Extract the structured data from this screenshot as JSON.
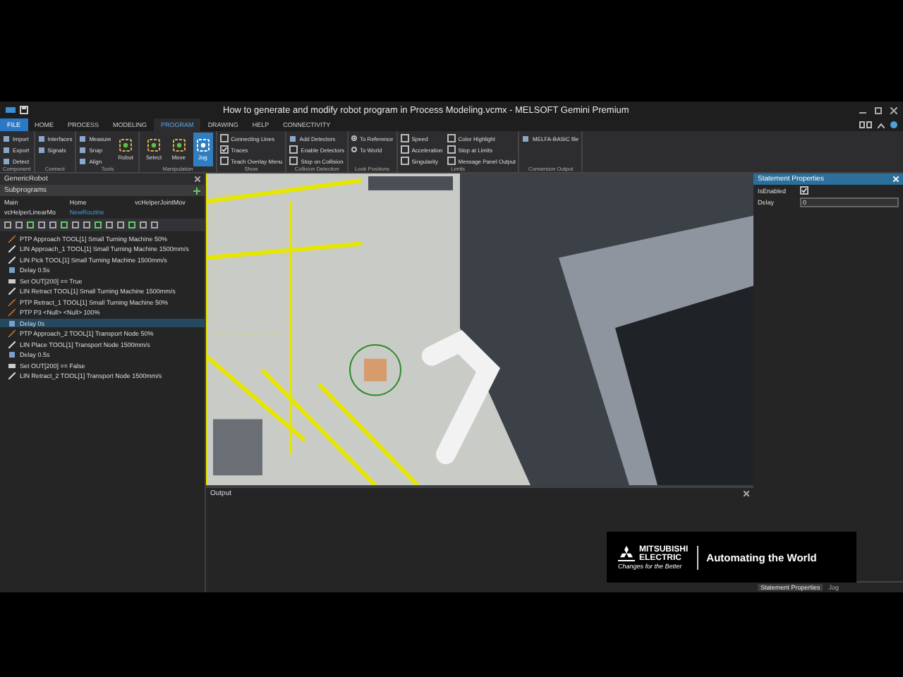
{
  "window": {
    "title": "How to generate and modify robot program in Process Modeling.vcmx - MELSOFT Gemini Premium"
  },
  "menu_tabs": [
    {
      "label": "FILE",
      "kind": "file",
      "selected": false
    },
    {
      "label": "HOME",
      "kind": "tab",
      "selected": false
    },
    {
      "label": "PROCESS",
      "kind": "tab",
      "selected": false
    },
    {
      "label": "MODELING",
      "kind": "tab",
      "selected": false
    },
    {
      "label": "PROGRAM",
      "kind": "tab",
      "selected": true
    },
    {
      "label": "DRAWING",
      "kind": "tab",
      "selected": false
    },
    {
      "label": "HELP",
      "kind": "tab",
      "selected": false
    },
    {
      "label": "CONNECTIVITY",
      "kind": "tab",
      "selected": false
    }
  ],
  "ribbon": [
    {
      "name": "Component",
      "items": [
        {
          "label": "Import",
          "kind": "small"
        },
        {
          "label": "Export",
          "kind": "small"
        },
        {
          "label": "Detect",
          "kind": "small"
        }
      ]
    },
    {
      "name": "Connect",
      "items": [
        {
          "label": "Interfaces",
          "kind": "small"
        },
        {
          "label": "Signals",
          "kind": "small"
        }
      ]
    },
    {
      "name": "Tools",
      "items": [
        {
          "label": "Measure",
          "kind": "small"
        },
        {
          "label": "Snap",
          "kind": "small"
        },
        {
          "label": "Align",
          "kind": "small"
        },
        {
          "label": "Robot",
          "kind": "large",
          "selected": false
        }
      ]
    },
    {
      "name": "Manipulation",
      "items": [
        {
          "label": "Select",
          "kind": "large",
          "selected": false
        },
        {
          "label": "Move",
          "kind": "large",
          "selected": false
        },
        {
          "label": "Jog",
          "kind": "large",
          "selected": true
        }
      ]
    },
    {
      "name": "Show",
      "items": [
        {
          "label": "Connecting Lines",
          "kind": "check",
          "checked": false
        },
        {
          "label": "Traces",
          "kind": "check",
          "checked": true
        },
        {
          "label": "Teach Overlay Menu",
          "kind": "check",
          "checked": false
        }
      ]
    },
    {
      "name": "Collision Detection",
      "items": [
        {
          "label": "Add Detectors",
          "kind": "small"
        },
        {
          "label": "Enable Detectors",
          "kind": "check",
          "checked": false
        },
        {
          "label": "Stop on Collision",
          "kind": "check",
          "checked": false
        }
      ]
    },
    {
      "name": "Look Positions",
      "items": [
        {
          "label": "To Reference",
          "kind": "radio",
          "checked": true
        },
        {
          "label": "To World",
          "kind": "radio",
          "checked": false
        }
      ]
    },
    {
      "name": "Limits",
      "items": [
        {
          "label": "Speed",
          "kind": "check",
          "checked": false
        },
        {
          "label": "Acceleration",
          "kind": "check",
          "checked": false
        },
        {
          "label": "Singularity",
          "kind": "check",
          "checked": false
        },
        {
          "label": "Color Highlight",
          "kind": "check",
          "checked": false
        },
        {
          "label": "Stop at Limits",
          "kind": "check",
          "checked": false
        },
        {
          "label": "Message Panel Output",
          "kind": "check",
          "checked": false
        }
      ]
    },
    {
      "name": "Conversion Output",
      "items": [
        {
          "label": "MELFA-BASIC file",
          "kind": "small"
        }
      ]
    }
  ],
  "program_panel": {
    "title": "GenericRobot",
    "section": "Subprograms",
    "subprograms": [
      {
        "label": "Main",
        "selected": false
      },
      {
        "label": "Home",
        "selected": false
      },
      {
        "label": "vcHelperJointMov",
        "selected": false
      },
      {
        "label": "vcHelperLinearMo",
        "selected": false
      },
      {
        "label": "NewRoutine",
        "selected": true
      }
    ],
    "statements": [
      {
        "text": "PTP Approach TOOL[1] Small Turning Machine 50%",
        "kind": "ptp",
        "selected": false
      },
      {
        "text": "LIN Approach_1 TOOL[1] Small Turning Machine 1500mm/s",
        "kind": "lin",
        "selected": false
      },
      {
        "text": "LIN Pick TOOL[1] Small Turning Machine 1500mm/s",
        "kind": "lin",
        "selected": false
      },
      {
        "text": "Delay 0.5s",
        "kind": "delay",
        "selected": false
      },
      {
        "text": "Set OUT[200] == True",
        "kind": "set",
        "selected": false
      },
      {
        "text": "LIN Retract TOOL[1] Small Turning Machine 1500mm/s",
        "kind": "lin",
        "selected": false
      },
      {
        "text": "PTP Retract_1 TOOL[1] Small Turning Machine 50%",
        "kind": "ptp",
        "selected": false
      },
      {
        "text": "PTP P3 <Null> <Null> 100%",
        "kind": "ptp",
        "selected": false
      },
      {
        "text": "Delay 0s",
        "kind": "delay",
        "selected": true
      },
      {
        "text": "PTP Approach_2 TOOL[1] Transport Node 50%",
        "kind": "ptp",
        "selected": false
      },
      {
        "text": "LIN Place TOOL[1] Transport Node 1500mm/s",
        "kind": "lin",
        "selected": false
      },
      {
        "text": "Delay 0.5s",
        "kind": "delay",
        "selected": false
      },
      {
        "text": "Set OUT[200] == False",
        "kind": "set",
        "selected": false
      },
      {
        "text": "LIN Retract_2 TOOL[1] Transport Node 1500mm/s",
        "kind": "lin",
        "selected": false
      }
    ]
  },
  "output": {
    "title": "Output"
  },
  "properties": {
    "title": "Statement Properties",
    "fields": [
      {
        "label": "IsEnabled",
        "kind": "check",
        "checked": true
      },
      {
        "label": "Delay",
        "kind": "input",
        "value": "0"
      }
    ]
  },
  "bottom_tabs": [
    {
      "label": "Statement Properties",
      "selected": true
    },
    {
      "label": "Jog",
      "selected": false
    }
  ],
  "banner": {
    "brand_line_1": "MITSUBISHI",
    "brand_line_2": "ELECTRIC",
    "slogan": "Changes for the Better",
    "tagline": "Automating the World"
  }
}
